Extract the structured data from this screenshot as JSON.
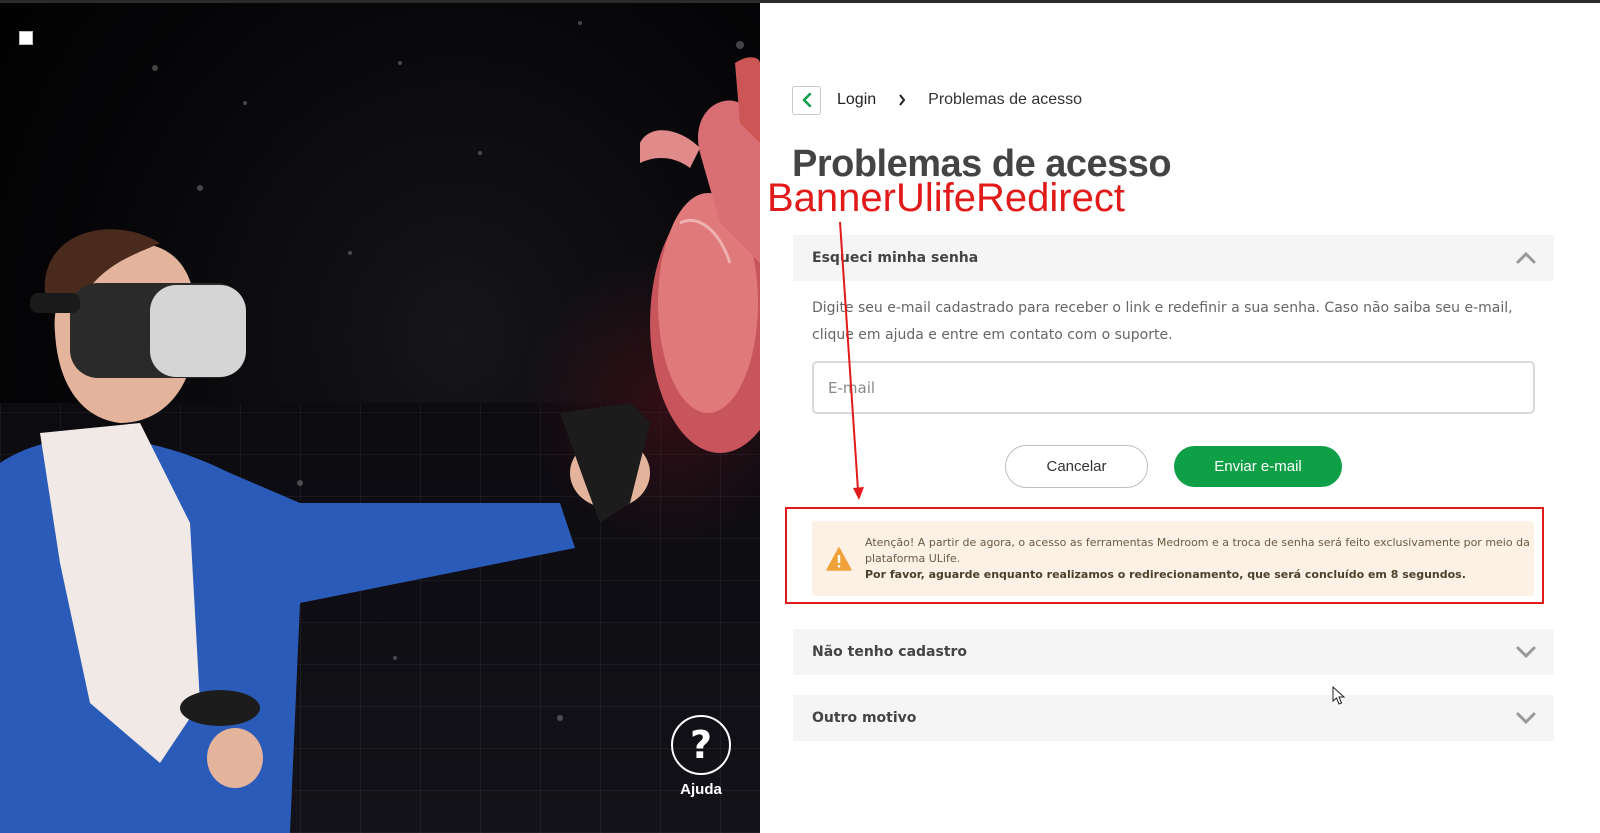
{
  "hero": {
    "help_label": "Ajuda",
    "help_symbol": "?"
  },
  "breadcrumb": {
    "back_icon": "chevron-left-icon",
    "login_label": "Login",
    "separator_icon": "chevron-right-icon",
    "current_label": "Problemas de acesso"
  },
  "page": {
    "title": "Problemas de acesso"
  },
  "accordion": {
    "forgot": {
      "title": "Esqueci minha senha",
      "description": "Digite seu e-mail cadastrado para receber o link e redefinir a sua senha. Caso não saiba seu e-mail, clique em ajuda e entre em contato com o suporte.",
      "email_placeholder": "E-mail",
      "email_value": "",
      "cancel_label": "Cancelar",
      "send_label": "Enviar e-mail",
      "expanded": true
    },
    "no_account": {
      "title": "Não tenho cadastro",
      "expanded": false
    },
    "other": {
      "title": "Outro motivo",
      "expanded": false
    }
  },
  "alert": {
    "icon": "warning-icon",
    "message": "Atenção! A partir de agora, o acesso as ferramentas Medroom e a troca de senha será feito exclusivamente por meio da plataforma ULife.",
    "redirect_message": "Por favor, aguarde enquanto realizamos o redirecionamento, que será concluído em 8 segundos."
  },
  "annotation": {
    "label": "BannerUlifeRedirect",
    "color": "#e21a1a"
  },
  "colors": {
    "primary_green": "#0e9f47",
    "title_gray": "#444444",
    "alert_bg": "#fcf1e4",
    "warning_orange": "#f0a23a"
  }
}
